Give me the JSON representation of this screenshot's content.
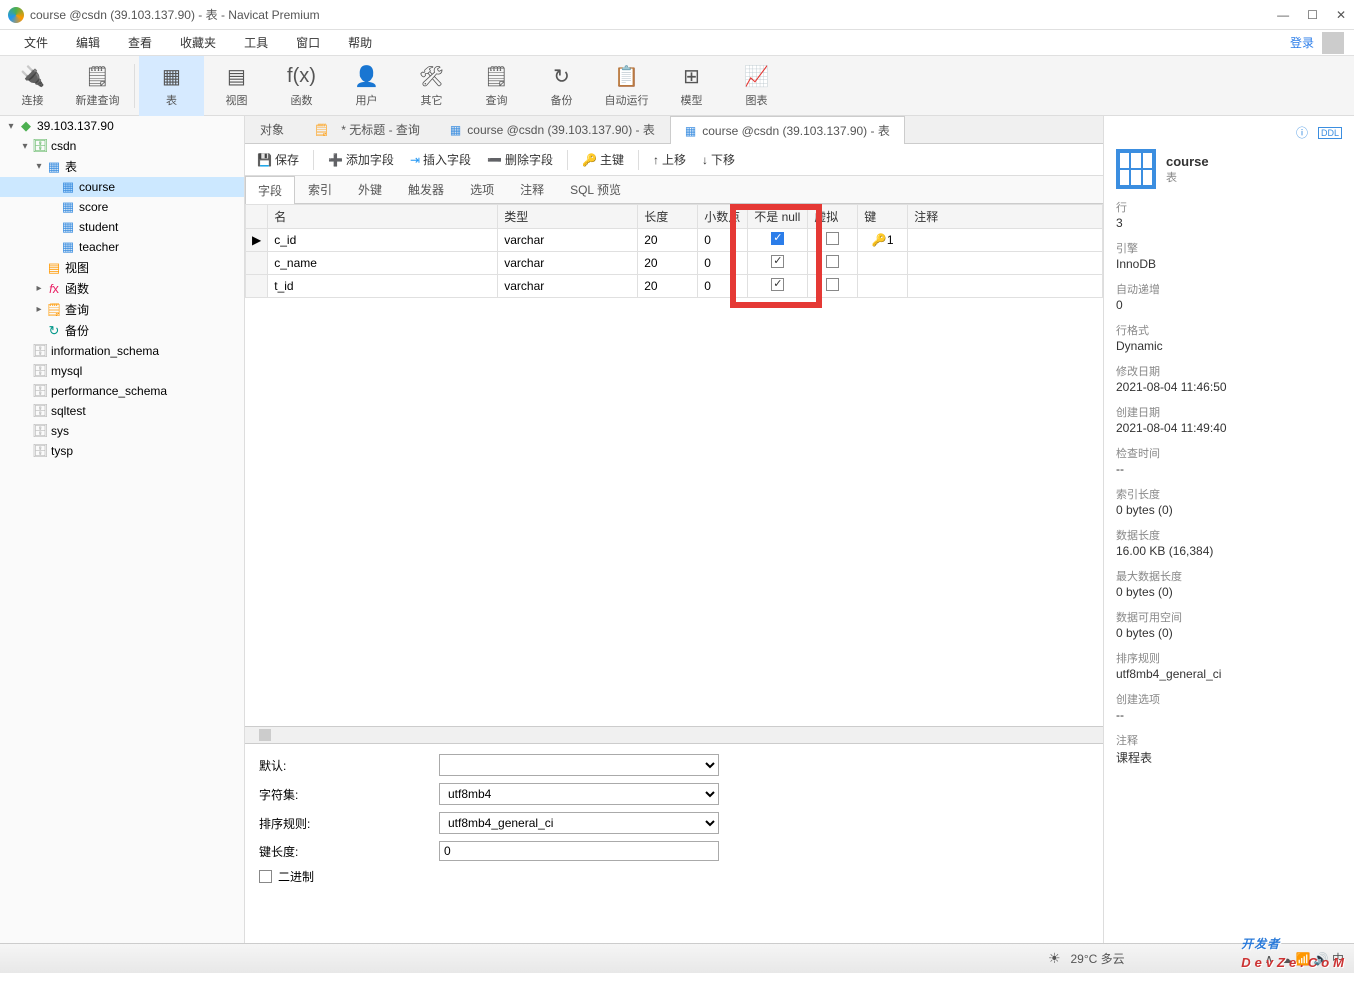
{
  "window": {
    "title": "course @csdn (39.103.137.90) - 表 - Navicat Premium"
  },
  "menubar": {
    "items": [
      "文件",
      "编辑",
      "查看",
      "收藏夹",
      "工具",
      "窗口",
      "帮助"
    ],
    "login": "登录"
  },
  "toolbar": {
    "items": [
      {
        "label": "连接",
        "icon": "🔌"
      },
      {
        "label": "新建查询",
        "icon": "🗒"
      },
      {
        "label": "表",
        "icon": "▦",
        "active": true
      },
      {
        "label": "视图",
        "icon": "▤"
      },
      {
        "label": "函数",
        "icon": "f(x)"
      },
      {
        "label": "用户",
        "icon": "👤"
      },
      {
        "label": "其它",
        "icon": "🛠"
      },
      {
        "label": "查询",
        "icon": "🗒"
      },
      {
        "label": "备份",
        "icon": "↻"
      },
      {
        "label": "自动运行",
        "icon": "📋"
      },
      {
        "label": "模型",
        "icon": "⊞"
      },
      {
        "label": "图表",
        "icon": "📈"
      }
    ]
  },
  "tree": {
    "connection": "39.103.137.90",
    "db": "csdn",
    "table_group": "表",
    "tables": [
      "course",
      "score",
      "student",
      "teacher"
    ],
    "views": "视图",
    "funcs": "函数",
    "queries": "查询",
    "backups": "备份",
    "other_dbs": [
      "information_schema",
      "mysql",
      "performance_schema",
      "sqltest",
      "sys",
      "tysp"
    ]
  },
  "doctabs": {
    "t0": "对象",
    "t1": "* 无标题 - 查询",
    "t2": "course @csdn (39.103.137.90) - 表",
    "t3": "course @csdn (39.103.137.90) - 表"
  },
  "actionbar": {
    "save": "保存",
    "add": "添加字段",
    "insert": "插入字段",
    "delete": "删除字段",
    "pk": "主键",
    "up": "上移",
    "down": "下移"
  },
  "subtabs": [
    "字段",
    "索引",
    "外键",
    "触发器",
    "选项",
    "注释",
    "SQL 预览"
  ],
  "grid": {
    "headers": {
      "name": "名",
      "type": "类型",
      "length": "长度",
      "decimal": "小数点",
      "notnull": "不是 null",
      "virtual": "虚拟",
      "key": "键",
      "comment": "注释"
    },
    "rows": [
      {
        "name": "c_id",
        "type": "varchar",
        "length": "20",
        "decimal": "0",
        "notnull": true,
        "virtual": false,
        "key": "1"
      },
      {
        "name": "c_name",
        "type": "varchar",
        "length": "20",
        "decimal": "0",
        "notnull": true,
        "virtual": false,
        "key": ""
      },
      {
        "name": "t_id",
        "type": "varchar",
        "length": "20",
        "decimal": "0",
        "notnull": true,
        "virtual": false,
        "key": ""
      }
    ]
  },
  "bottom": {
    "default_label": "默认:",
    "charset_label": "字符集:",
    "charset": "utf8mb4",
    "collation_label": "排序规则:",
    "collation": "utf8mb4_general_ci",
    "keylen_label": "键长度:",
    "keylen": "0",
    "binary_label": "二进制"
  },
  "rightpanel": {
    "title": "course",
    "subtitle": "表",
    "sections": [
      {
        "label": "行",
        "value": "3"
      },
      {
        "label": "引擎",
        "value": "InnoDB"
      },
      {
        "label": "自动递增",
        "value": "0"
      },
      {
        "label": "行格式",
        "value": "Dynamic"
      },
      {
        "label": "修改日期",
        "value": "2021-08-04 11:46:50"
      },
      {
        "label": "创建日期",
        "value": "2021-08-04 11:49:40"
      },
      {
        "label": "检查时间",
        "value": "--"
      },
      {
        "label": "索引长度",
        "value": "0 bytes (0)"
      },
      {
        "label": "数据长度",
        "value": "16.00 KB (16,384)"
      },
      {
        "label": "最大数据长度",
        "value": "0 bytes (0)"
      },
      {
        "label": "数据可用空间",
        "value": "0 bytes (0)"
      },
      {
        "label": "排序规则",
        "value": "utf8mb4_general_ci"
      },
      {
        "label": "创建选项",
        "value": "--"
      },
      {
        "label": "注释",
        "value": "课程表"
      }
    ]
  },
  "statusbar": {
    "weather": "29°C 多云"
  },
  "watermark": {
    "main": "开发者",
    "sub": "DevZe.CoM"
  }
}
